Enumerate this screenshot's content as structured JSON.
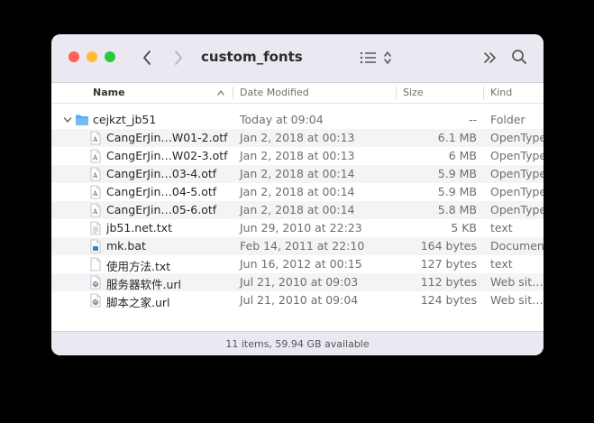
{
  "window": {
    "title": "custom_fonts"
  },
  "columns": {
    "name": "Name",
    "date": "Date Modified",
    "size": "Size",
    "kind": "Kind"
  },
  "files": [
    {
      "name": "cejkzt_jb51",
      "date": "Today at 09:04",
      "size": "--",
      "kind": "Folder",
      "icon": "folder-icon",
      "level": 0,
      "expanded": true
    },
    {
      "name": "CangErJin…W01-2.otf",
      "date": "Jan 2, 2018 at 00:13",
      "size": "6.1 MB",
      "kind": "OpenType",
      "icon": "font-file-icon",
      "level": 1
    },
    {
      "name": "CangErJin…W02-3.otf",
      "date": "Jan 2, 2018 at 00:13",
      "size": "6 MB",
      "kind": "OpenType",
      "icon": "font-file-icon",
      "level": 1
    },
    {
      "name": "CangErJin…03-4.otf",
      "date": "Jan 2, 2018 at 00:14",
      "size": "5.9 MB",
      "kind": "OpenType",
      "icon": "font-file-icon",
      "level": 1
    },
    {
      "name": "CangErJin…04-5.otf",
      "date": "Jan 2, 2018 at 00:14",
      "size": "5.9 MB",
      "kind": "OpenType",
      "icon": "font-file-icon",
      "level": 1
    },
    {
      "name": "CangErJin…05-6.otf",
      "date": "Jan 2, 2018 at 00:14",
      "size": "5.8 MB",
      "kind": "OpenType",
      "icon": "font-file-icon",
      "level": 1
    },
    {
      "name": "jb51.net.txt",
      "date": "Jun 29, 2010 at 22:23",
      "size": "5 KB",
      "kind": "text",
      "icon": "text-file-icon",
      "level": 1
    },
    {
      "name": "mk.bat",
      "date": "Feb 14, 2011 at 22:10",
      "size": "164 bytes",
      "kind": "Document",
      "icon": "bat-file-icon",
      "level": 1
    },
    {
      "name": "使用方法.txt",
      "date": "Jun 16, 2012 at 00:15",
      "size": "127 bytes",
      "kind": "text",
      "icon": "blank-file-icon",
      "level": 1
    },
    {
      "name": "服务器软件.url",
      "date": "Jul 21, 2010 at 09:03",
      "size": "112 bytes",
      "kind": "Web sit…c",
      "icon": "url-file-icon",
      "level": 1
    },
    {
      "name": "脚本之家.url",
      "date": "Jul 21, 2010 at 09:04",
      "size": "124 bytes",
      "kind": "Web sit…c",
      "icon": "url-file-icon",
      "level": 1
    }
  ],
  "status": {
    "text": "11 items, 59.94 GB available"
  },
  "colors": {
    "titlebar": "#ebe8f1",
    "folder": "#5aa9f0",
    "close": "#fe5f57",
    "minimize": "#febc2e",
    "maximize": "#28c840"
  }
}
